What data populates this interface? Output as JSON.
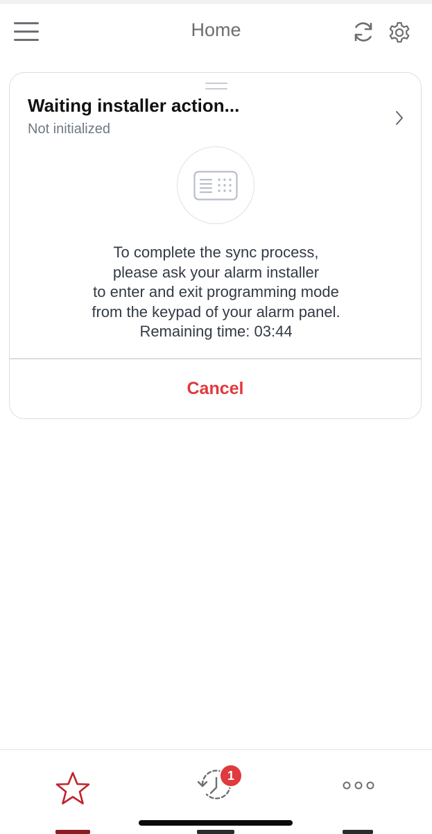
{
  "header": {
    "title": "Home",
    "menu_icon": "hamburger-menu-icon",
    "sync_icon": "sync-icon",
    "settings_icon": "gear-icon"
  },
  "card": {
    "title": "Waiting installer action...",
    "subtitle": "Not initialized",
    "keypad_icon": "keypad-icon",
    "message_lines": [
      "To complete the sync process,",
      "please ask your alarm installer",
      "to enter and exit programming mode",
      "from the keypad of your alarm panel.",
      "Remaining time: 03:44"
    ],
    "cancel_label": "Cancel"
  },
  "tabbar": {
    "favorites_icon": "star-icon",
    "history_icon": "history-icon",
    "history_badge": "1",
    "more_icon": "more-dots-icon"
  },
  "colors": {
    "accent": "#e0393e",
    "favorites_active": "#c0222a",
    "text_primary": "#111111",
    "text_secondary": "#6f7785",
    "icon_gray": "#6d6d72"
  }
}
